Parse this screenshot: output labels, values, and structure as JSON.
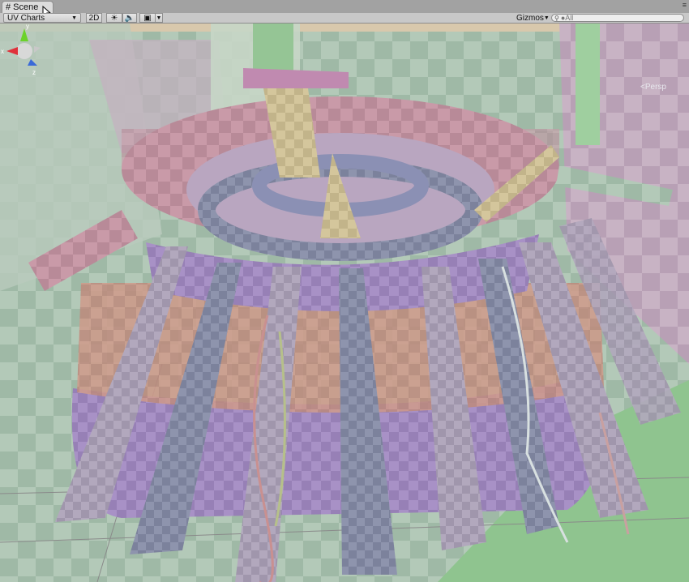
{
  "tab": {
    "title": "Scene",
    "icon": "grid-icon"
  },
  "toolbar": {
    "draw_mode": "UV Charts",
    "mode_2d": "2D",
    "gizmos_label": "Gizmos",
    "search_placeholder": "●All"
  },
  "gizmo": {
    "x": "x",
    "y": "y",
    "z": "z",
    "projection": "<Persp"
  },
  "colors": {
    "x_axis": "#e0303a",
    "y_axis": "#6cd22a",
    "z_axis": "#3a6ad8"
  }
}
